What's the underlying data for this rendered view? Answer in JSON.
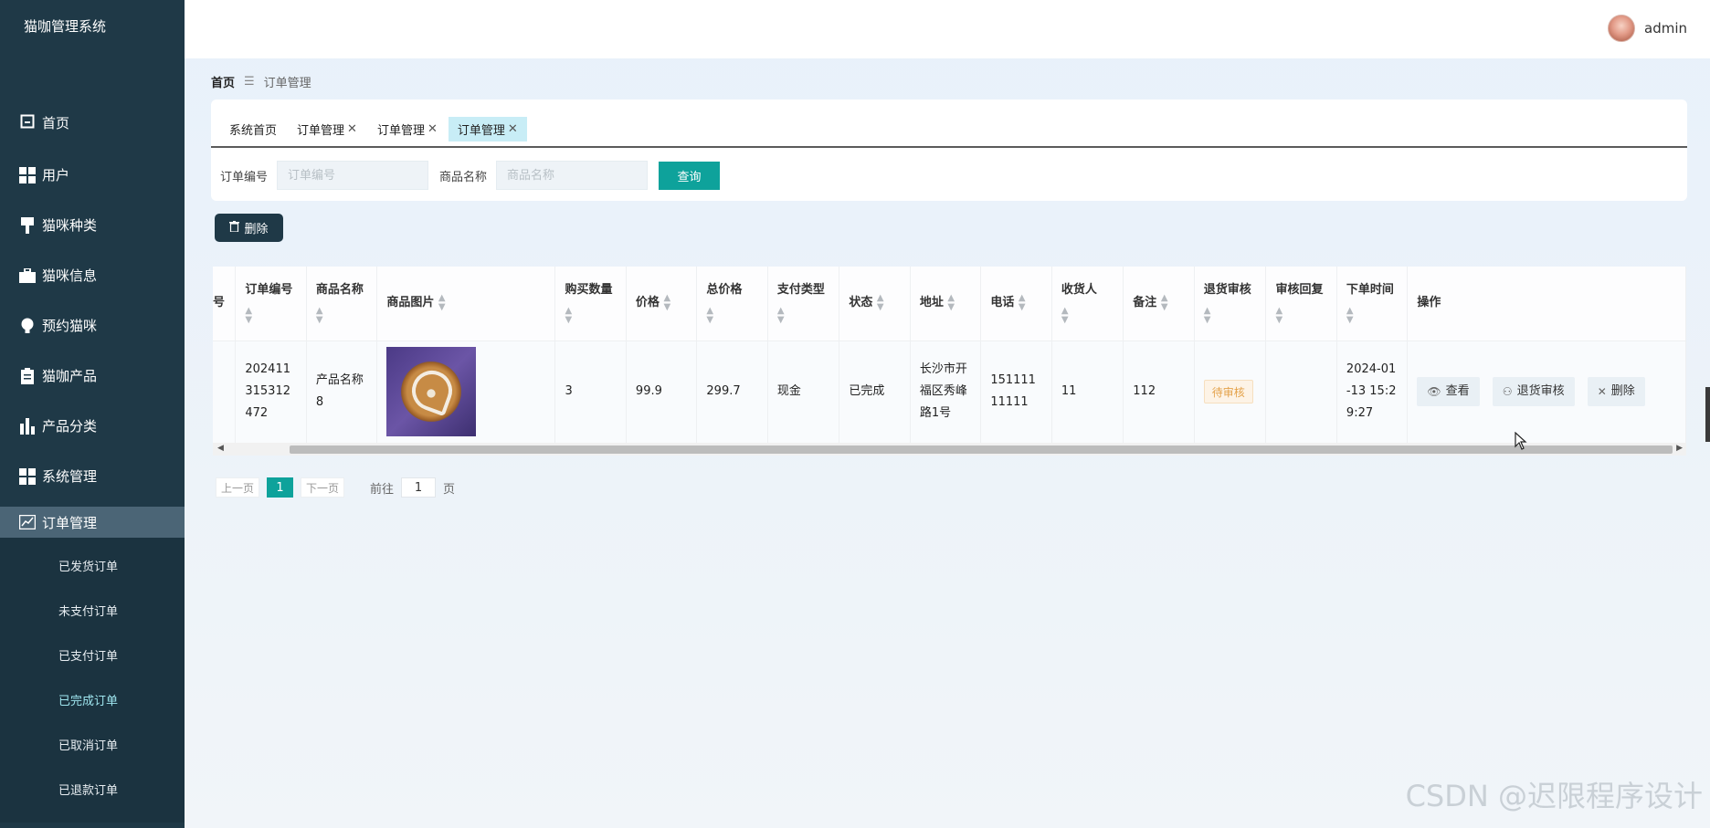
{
  "app": {
    "title": "猫咖管理系统"
  },
  "sidebar": {
    "items": [
      {
        "label": "首页",
        "icon": "home-icon"
      },
      {
        "label": "用户",
        "icon": "grid-icon"
      },
      {
        "label": "猫咪种类",
        "icon": "brush-icon"
      },
      {
        "label": "猫咪信息",
        "icon": "briefcase-icon"
      },
      {
        "label": "预约猫咪",
        "icon": "bulb-icon"
      },
      {
        "label": "猫咖产品",
        "icon": "clipboard-icon"
      },
      {
        "label": "产品分类",
        "icon": "bar-chart-icon"
      },
      {
        "label": "系统管理",
        "icon": "grid-icon"
      },
      {
        "label": "订单管理",
        "icon": "trend-icon"
      }
    ],
    "sub_items": [
      "已发货订单",
      "未支付订单",
      "已支付订单",
      "已完成订单",
      "已取消订单",
      "已退款订单"
    ]
  },
  "header": {
    "username": "admin"
  },
  "breadcrumb": {
    "home": "首页",
    "current": "订单管理"
  },
  "tabs": [
    "系统首页",
    "订单管理",
    "订单管理",
    "订单管理"
  ],
  "search": {
    "order_no_label": "订单编号",
    "order_no_placeholder": "订单编号",
    "product_label": "商品名称",
    "product_placeholder": "商品名称",
    "query_label": "查询"
  },
  "toolbar": {
    "delete_label": "删除"
  },
  "table": {
    "headers": {
      "no": "号",
      "order_no": "订单编号",
      "product_name": "商品名称",
      "product_image": "商品图片",
      "quantity": "购买数量",
      "price": "价格",
      "total": "总价格",
      "pay_type": "支付类型",
      "status": "状态",
      "address": "地址",
      "phone": "电话",
      "receiver": "收货人",
      "remark": "备注",
      "return_review": "退货审核",
      "review_reply": "审核回复",
      "order_time": "下单时间",
      "actions": "操作"
    },
    "rows": [
      {
        "order_no": "202411315312472",
        "product_name": "产品名称8",
        "quantity": "3",
        "price": "99.9",
        "total": "299.7",
        "pay_type": "现金",
        "status": "已完成",
        "address": "长沙市开福区秀峰路1号",
        "phone": "15111111111",
        "receiver": "11",
        "remark": "112",
        "return_review": "待审核",
        "review_reply": "",
        "order_time": "2024-01-13 15:29:27",
        "actions": {
          "view": "查看",
          "review": "退货审核",
          "delete": "删除"
        }
      }
    ]
  },
  "pagination": {
    "prev": "上一页",
    "page": "1",
    "next": "下一页",
    "goto": "前往",
    "goto_value": "1",
    "unit": "页"
  },
  "watermark": "CSDN @迟限程序设计"
}
